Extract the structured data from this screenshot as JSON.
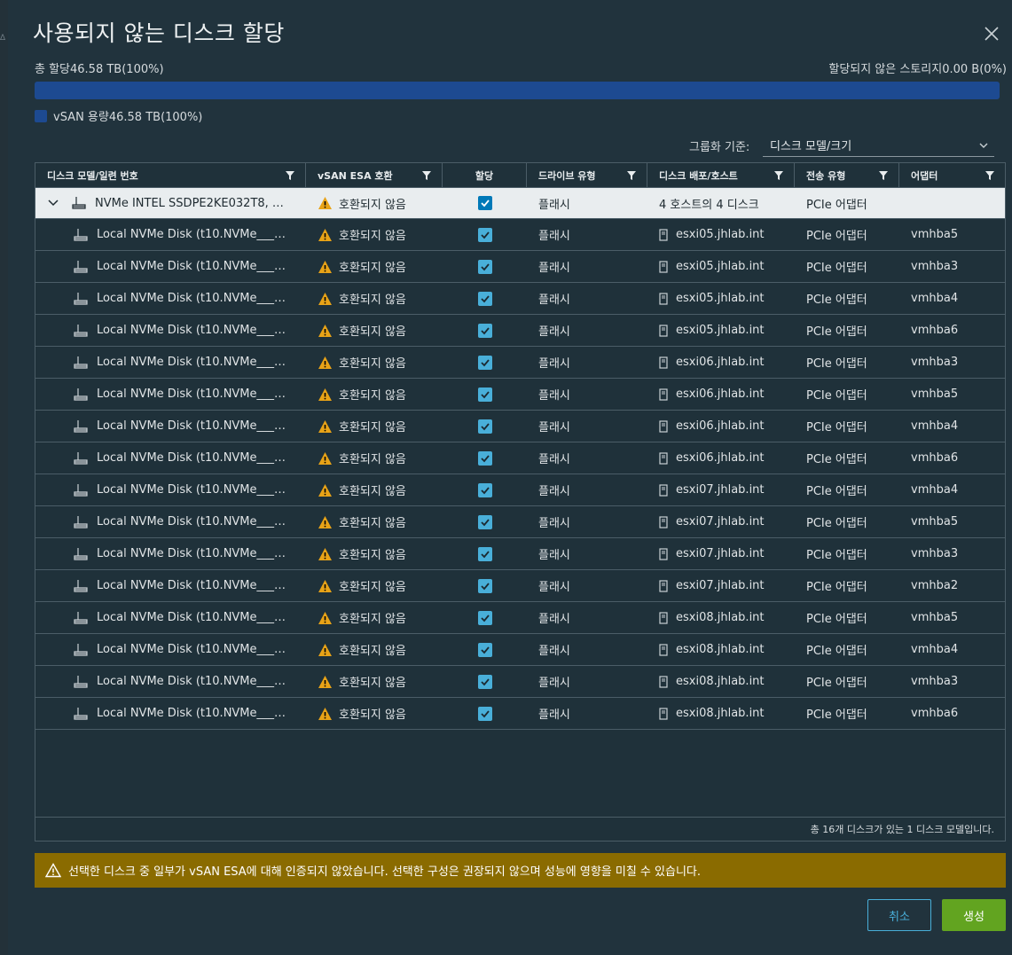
{
  "dialog": {
    "title": "사용되지 않는 디스크 할당",
    "close_icon": "close-icon"
  },
  "capacity": {
    "total_label": "총 할당46.58 TB(100%)",
    "unallocated_label": "할당되지 않은 스토리지0.00 B(0%)",
    "allocated_percent": 100,
    "bar_color": "#1d4a91",
    "legend_label": "vSAN 용량46.58 TB(100%)"
  },
  "grouping": {
    "label": "그룹화 기준:",
    "value": "디스크 모델/크기"
  },
  "table": {
    "headers": [
      "디스크 모델/일련 번호",
      "vSAN ESA 호환",
      "할당",
      "드라이브 유형",
      "디스크 배포/호스트",
      "전송 유형",
      "어댑터"
    ],
    "group_row": {
      "model": "NVMe INTEL SSDPE2KE032T8, 2.9...",
      "compat": "호환되지 않음",
      "drive_type": "플래시",
      "distribution": "4 호스트의 4 디스크",
      "transport": "PCIe 어댑터",
      "adapter": ""
    },
    "rows": [
      {
        "name": "Local NVMe Disk (t10.NVMe____I...",
        "compat": "호환되지 않음",
        "drive_type": "플래시",
        "host": "esxi05.jhlab.int",
        "transport": "PCIe 어댑터",
        "adapter": "vmhba5"
      },
      {
        "name": "Local NVMe Disk (t10.NVMe____I...",
        "compat": "호환되지 않음",
        "drive_type": "플래시",
        "host": "esxi05.jhlab.int",
        "transport": "PCIe 어댑터",
        "adapter": "vmhba3"
      },
      {
        "name": "Local NVMe Disk (t10.NVMe____I...",
        "compat": "호환되지 않음",
        "drive_type": "플래시",
        "host": "esxi05.jhlab.int",
        "transport": "PCIe 어댑터",
        "adapter": "vmhba4"
      },
      {
        "name": "Local NVMe Disk (t10.NVMe____I...",
        "compat": "호환되지 않음",
        "drive_type": "플래시",
        "host": "esxi05.jhlab.int",
        "transport": "PCIe 어댑터",
        "adapter": "vmhba6"
      },
      {
        "name": "Local NVMe Disk (t10.NVMe____I...",
        "compat": "호환되지 않음",
        "drive_type": "플래시",
        "host": "esxi06.jhlab.int",
        "transport": "PCIe 어댑터",
        "adapter": "vmhba3"
      },
      {
        "name": "Local NVMe Disk (t10.NVMe____I...",
        "compat": "호환되지 않음",
        "drive_type": "플래시",
        "host": "esxi06.jhlab.int",
        "transport": "PCIe 어댑터",
        "adapter": "vmhba5"
      },
      {
        "name": "Local NVMe Disk (t10.NVMe____I...",
        "compat": "호환되지 않음",
        "drive_type": "플래시",
        "host": "esxi06.jhlab.int",
        "transport": "PCIe 어댑터",
        "adapter": "vmhba4"
      },
      {
        "name": "Local NVMe Disk (t10.NVMe____I...",
        "compat": "호환되지 않음",
        "drive_type": "플래시",
        "host": "esxi06.jhlab.int",
        "transport": "PCIe 어댑터",
        "adapter": "vmhba6"
      },
      {
        "name": "Local NVMe Disk (t10.NVMe____I...",
        "compat": "호환되지 않음",
        "drive_type": "플래시",
        "host": "esxi07.jhlab.int",
        "transport": "PCIe 어댑터",
        "adapter": "vmhba4"
      },
      {
        "name": "Local NVMe Disk (t10.NVMe____I...",
        "compat": "호환되지 않음",
        "drive_type": "플래시",
        "host": "esxi07.jhlab.int",
        "transport": "PCIe 어댑터",
        "adapter": "vmhba5"
      },
      {
        "name": "Local NVMe Disk (t10.NVMe____I...",
        "compat": "호환되지 않음",
        "drive_type": "플래시",
        "host": "esxi07.jhlab.int",
        "transport": "PCIe 어댑터",
        "adapter": "vmhba3"
      },
      {
        "name": "Local NVMe Disk (t10.NVMe____I...",
        "compat": "호환되지 않음",
        "drive_type": "플래시",
        "host": "esxi07.jhlab.int",
        "transport": "PCIe 어댑터",
        "adapter": "vmhba2"
      },
      {
        "name": "Local NVMe Disk (t10.NVMe____I...",
        "compat": "호환되지 않음",
        "drive_type": "플래시",
        "host": "esxi08.jhlab.int",
        "transport": "PCIe 어댑터",
        "adapter": "vmhba5"
      },
      {
        "name": "Local NVMe Disk (t10.NVMe____I...",
        "compat": "호환되지 않음",
        "drive_type": "플래시",
        "host": "esxi08.jhlab.int",
        "transport": "PCIe 어댑터",
        "adapter": "vmhba4"
      },
      {
        "name": "Local NVMe Disk (t10.NVMe____I...",
        "compat": "호환되지 않음",
        "drive_type": "플래시",
        "host": "esxi08.jhlab.int",
        "transport": "PCIe 어댑터",
        "adapter": "vmhba3"
      },
      {
        "name": "Local NVMe Disk (t10.NVMe____I...",
        "compat": "호환되지 않음",
        "drive_type": "플래시",
        "host": "esxi08.jhlab.int",
        "transport": "PCIe 어댑터",
        "adapter": "vmhba6"
      }
    ],
    "footer": "총 16개 디스크가 있는 1 디스크 모델입니다."
  },
  "alert": {
    "message": "선택한 디스크 중 일부가 vSAN ESA에 대해 인증되지 않았습니다. 선택한 구성은 권장되지 않으며 성능에 영향을 미칠 수 있습니다.",
    "color": "#8a6b00"
  },
  "buttons": {
    "cancel": "취소",
    "create": "생성"
  },
  "colors": {
    "accent": "#49afd9",
    "create": "#62a420",
    "warning": "#e8a317"
  }
}
